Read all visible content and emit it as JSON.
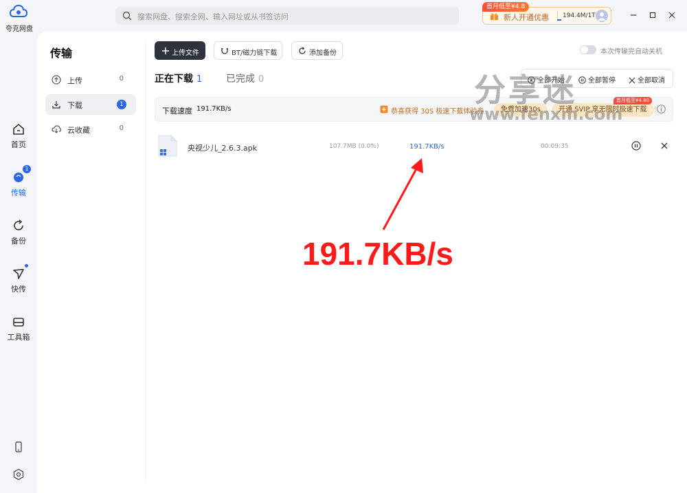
{
  "app": {
    "name": "夸克网盘"
  },
  "rail": {
    "items": [
      {
        "label": "首页",
        "icon": "home-icon"
      },
      {
        "label": "传输",
        "icon": "transfer-icon",
        "badge": "1"
      },
      {
        "label": "备份",
        "icon": "backup-icon"
      },
      {
        "label": "快传",
        "icon": "quick-send-icon"
      },
      {
        "label": "工具箱",
        "icon": "toolbox-icon"
      }
    ],
    "bottom": [
      "phone-icon",
      "settings-icon"
    ]
  },
  "search": {
    "placeholder": "搜索网盘、搜索全网、输入网址或从书签访问"
  },
  "promo": {
    "tag": "首月低至¥4.8",
    "text": "新人开通优惠",
    "quota": "194.4M/1T"
  },
  "subnav": {
    "title": "传输",
    "items": [
      {
        "label": "上传",
        "count": "0"
      },
      {
        "label": "下载",
        "count": "1"
      },
      {
        "label": "云收藏",
        "count": "0"
      }
    ]
  },
  "toolbar": {
    "upload": "上传文件",
    "bt": "BT/磁力链下载",
    "backup": "添加备份",
    "auto_shutdown": "本次传输完自动关机"
  },
  "tabs": {
    "downloading": {
      "label": "正在下载",
      "count": "1"
    },
    "completed": {
      "label": "已完成",
      "count": "0"
    }
  },
  "actions": {
    "start_all": "全部开始",
    "pause_all": "全部暂停",
    "cancel_all": "全部取消"
  },
  "speedbar": {
    "label": "下载速度",
    "value": "191.7KB/s",
    "offer": "恭喜获得 30S 极速下载体验券",
    "trial": "免费加速30s",
    "svip": "开通 SVIP 享无限时极速下载",
    "svip_tag": "首月低至¥4.80"
  },
  "file": {
    "name": "央视少儿_2.6.3.apk",
    "size": "107.7MB (0.0%)",
    "speed": "191.7KB/s",
    "time": "00:09:35"
  },
  "watermark": {
    "text": "分享迷",
    "url": "www.fenxm.com"
  },
  "annotation": {
    "text": "191.7KB/s"
  },
  "colors": {
    "accent": "#2b65e8",
    "annotation": "#ff1a1a",
    "dark_button": "#2e323c"
  }
}
